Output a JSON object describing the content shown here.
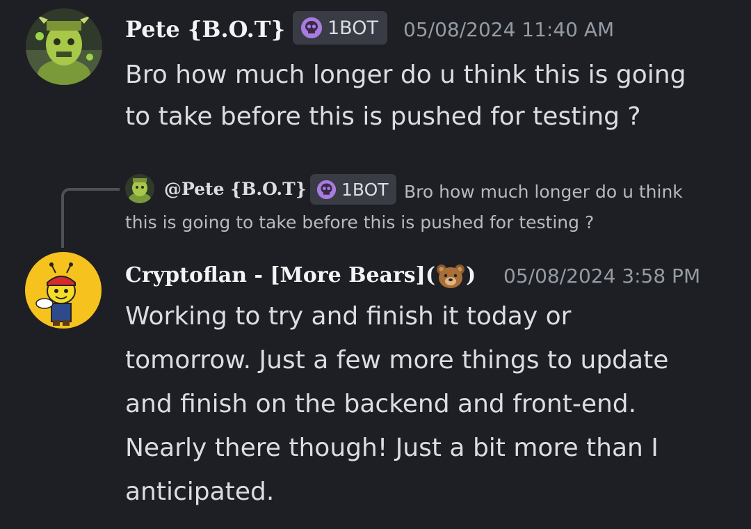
{
  "messages": [
    {
      "author": "Pete {B.O.T}",
      "tag": "1BOT",
      "timestamp": "05/08/2024 11:40 AM",
      "lines": [
        "Bro how much longer do u think this is going",
        "to take before this is pushed for testing ?"
      ]
    },
    {
      "reply": {
        "mention": "@Pete {B.O.T}",
        "tag": "1BOT",
        "preview_line1": "Bro how much longer do u think",
        "preview_line2": "this is going to take before this is pushed for testing ?"
      },
      "author": "Cryptoflan - [More Bears](",
      "author_suffix": ")",
      "author_emoji": "bear-face-emoji",
      "timestamp": "05/08/2024 3:58 PM",
      "lines": [
        "Working to try and finish it today or",
        "tomorrow. Just a few more things to update",
        "and finish on the backend and front-end.",
        "Nearly there though! Just a bit more than I",
        "anticipated."
      ]
    }
  ],
  "colors": {
    "background": "#1e1f24",
    "tag_background": "#3a3c45",
    "skull": "#a87cdd",
    "timestamp": "#949ba4",
    "message_text": "#dbdee1"
  }
}
